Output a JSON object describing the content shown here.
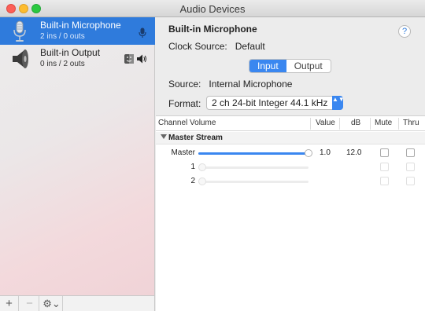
{
  "window": {
    "title": "Audio Devices"
  },
  "devices": [
    {
      "name": "Built-in Microphone",
      "sub": "2 ins / 0 outs",
      "selected": true
    },
    {
      "name": "Built-in Output",
      "sub": "0 ins / 2 outs",
      "selected": false
    }
  ],
  "bottombar": {
    "add": "+",
    "remove": "−",
    "gear": "⚙︎⌄"
  },
  "main": {
    "title": "Built-in Microphone",
    "help": "?",
    "clock": "Clock Source:   Default",
    "tabs": [
      "Input",
      "Output"
    ],
    "active_tab": "Input",
    "source": "Source:   Internal Microphone",
    "format_label": "Format:",
    "format_value": "2 ch 24-bit Integer 44.1 kHz",
    "format_arrows": "▲▼"
  },
  "table": {
    "headers": {
      "channel": "Channel Volume",
      "value": "Value",
      "db": "dB",
      "mute": "Mute",
      "thru": "Thru"
    },
    "group": "Master Stream",
    "rows": [
      {
        "label": "Master",
        "value": "1.0",
        "db": "12.0",
        "level": 1.0,
        "enabled": true
      },
      {
        "label": "1",
        "value": "",
        "db": "",
        "level": 0.0,
        "enabled": false
      },
      {
        "label": "2",
        "value": "",
        "db": "",
        "level": 0.0,
        "enabled": false
      }
    ]
  },
  "colors": {
    "accent": "#2f7bdc",
    "close": "#fc5f57",
    "minimize": "#fdbc2e",
    "maximize": "#2ac940"
  }
}
